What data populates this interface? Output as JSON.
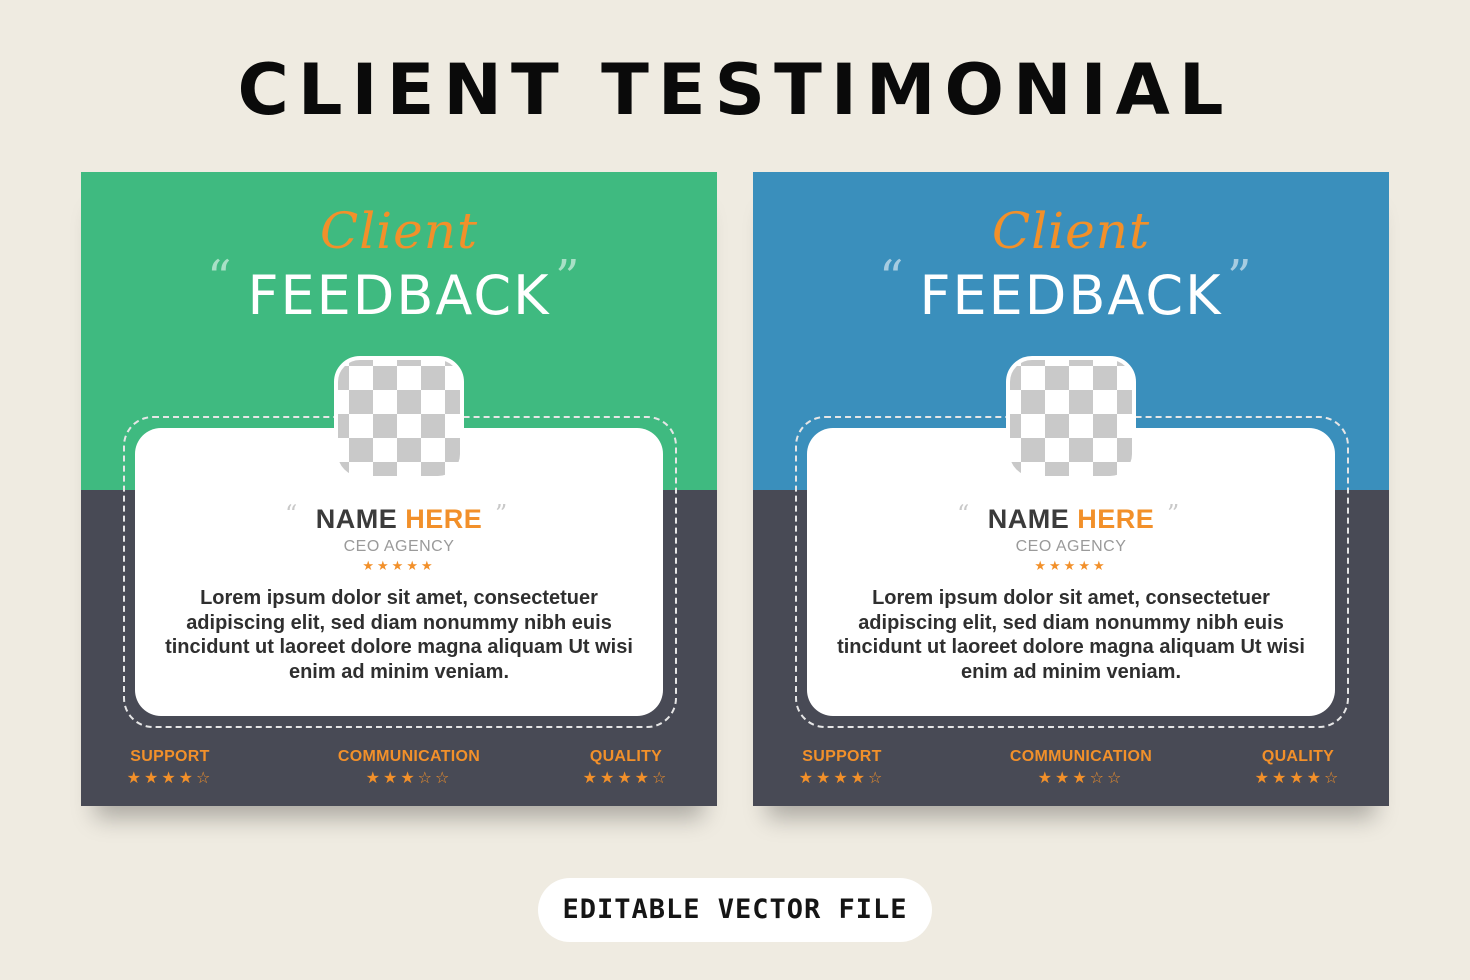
{
  "page": {
    "title": "CLIENT TESTIMONIAL",
    "footer_label": "EDITABLE VECTOR FILE"
  },
  "colors": {
    "background": "#efebe1",
    "card_left_top": "#3fba80",
    "card_right_top": "#3a8fbc",
    "card_bottom": "#484a55",
    "accent_orange": "#f2902a"
  },
  "cards": [
    {
      "script_title": "Client",
      "main_title": "FEEDBACK",
      "quote_open": "“",
      "quote_close": "”",
      "photo_icon": "placeholder-photo-icon",
      "name_first": "NAME ",
      "name_last": "HERE",
      "role": "CEO AGENCY",
      "rating_stars": "★★★★★",
      "body": "Lorem ipsum dolor sit amet, consectetuer adipiscing elit, sed diam nonummy nibh euis tincidunt ut laoreet dolore magna aliquam Ut wisi enim ad minim veniam.",
      "metrics": [
        {
          "label": "SUPPORT",
          "stars": "★★★★☆",
          "rating": 4,
          "max": 5
        },
        {
          "label": "COMMUNICATION",
          "stars": "★★★☆☆",
          "rating": 3,
          "max": 5
        },
        {
          "label": "QUALITY",
          "stars": "★★★★☆",
          "rating": 4,
          "max": 5
        }
      ]
    },
    {
      "script_title": "Client",
      "main_title": "FEEDBACK",
      "quote_open": "“",
      "quote_close": "”",
      "photo_icon": "placeholder-photo-icon",
      "name_first": "NAME ",
      "name_last": "HERE",
      "role": "CEO AGENCY",
      "rating_stars": "★★★★★",
      "body": "Lorem ipsum dolor sit amet, consectetuer adipiscing elit, sed diam nonummy nibh euis tincidunt ut laoreet dolore magna aliquam Ut wisi enim ad minim veniam.",
      "metrics": [
        {
          "label": "SUPPORT",
          "stars": "★★★★☆",
          "rating": 4,
          "max": 5
        },
        {
          "label": "COMMUNICATION",
          "stars": "★★★☆☆",
          "rating": 3,
          "max": 5
        },
        {
          "label": "QUALITY",
          "stars": "★★★★☆",
          "rating": 4,
          "max": 5
        }
      ]
    }
  ]
}
